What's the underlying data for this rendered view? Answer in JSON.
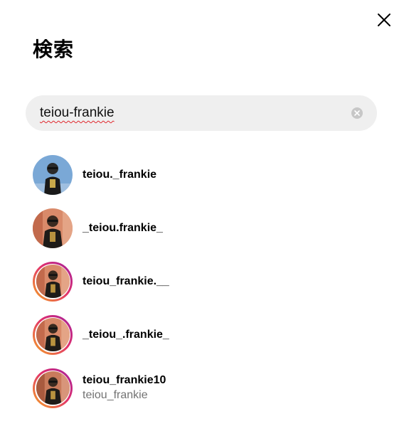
{
  "header": {
    "title": "検索"
  },
  "search": {
    "value": "teiou-frankie"
  },
  "results": [
    {
      "username": "teiou._frankie",
      "subtitle": "",
      "avatar_style": "blue"
    },
    {
      "username": "_teiou.frankie_",
      "subtitle": "",
      "avatar_style": "warm"
    },
    {
      "username": "teiou_frankie.__",
      "subtitle": "",
      "avatar_style": "warm-story"
    },
    {
      "username": "_teiou_.frankie_",
      "subtitle": "",
      "avatar_style": "warm-story"
    },
    {
      "username": "teiou_frankie10",
      "subtitle": "teiou_frankie",
      "avatar_style": "warm-story"
    }
  ],
  "icons": {
    "close": "close-icon",
    "clear": "clear-icon"
  },
  "colors": {
    "search_bg": "#efefef",
    "subtitle": "#737373",
    "story_ring_start": "#f5a623",
    "story_ring_end": "#a020a0"
  }
}
